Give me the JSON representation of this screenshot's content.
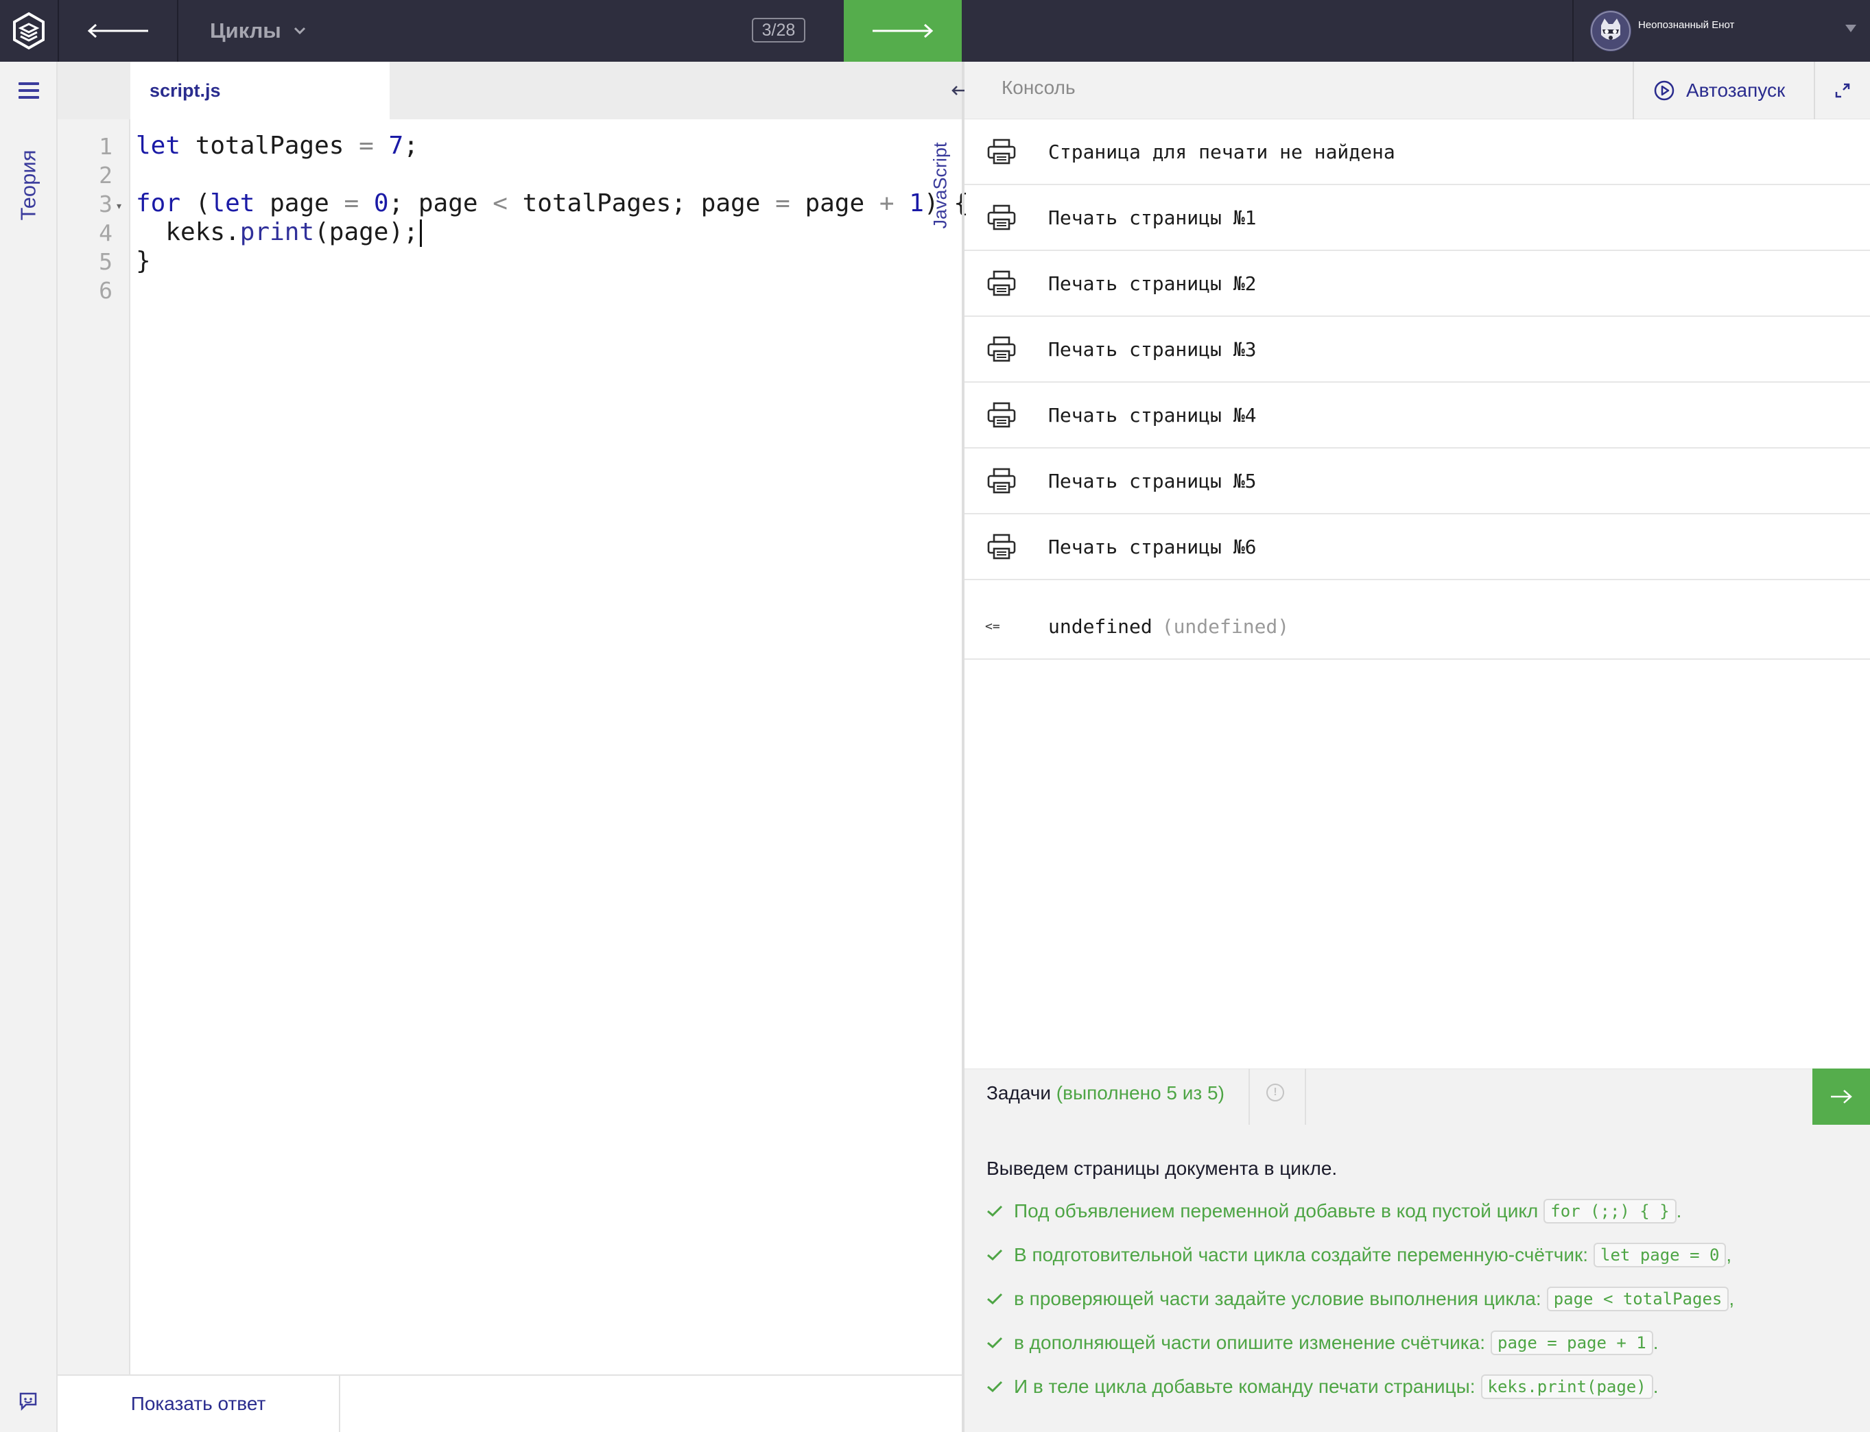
{
  "topbar": {
    "topic": "Циклы",
    "counter": "3/28",
    "user_name": "Неопознанный Енот"
  },
  "sidebar": {
    "theory_label": "Теория",
    "show_answer": "Показать ответ"
  },
  "editor": {
    "file_tab": "script.js",
    "language": "JavaScript",
    "line_numbers": [
      "1",
      "2",
      "3",
      "4",
      "5",
      "6"
    ],
    "code_lines": [
      "let totalPages = 7;",
      "",
      "for (let page = 0; page < totalPages; page = page + 1) {",
      "  keks.print(page);",
      "}",
      ""
    ]
  },
  "console": {
    "title": "Консоль",
    "autorun_label": "Автозапуск",
    "entries": [
      {
        "icon": "printer-icon",
        "text": "Страница для печати не найдена"
      },
      {
        "icon": "printer-icon",
        "text": "Печать страницы №1"
      },
      {
        "icon": "printer-icon",
        "text": "Печать страницы №2"
      },
      {
        "icon": "printer-icon",
        "text": "Печать страницы №3"
      },
      {
        "icon": "printer-icon",
        "text": "Печать страницы №4"
      },
      {
        "icon": "printer-icon",
        "text": "Печать страницы №5"
      },
      {
        "icon": "printer-icon",
        "text": "Печать страницы №6"
      }
    ],
    "return_marker": "<=",
    "return_value": "undefined",
    "return_type": "(undefined)"
  },
  "tasks": {
    "title": "Задачи",
    "progress": "(выполнено 5 из 5)",
    "intro": "Выведем страницы документа в цикле.",
    "items": [
      {
        "text": "Под объявлением переменной добавьте в код пустой цикл",
        "code": "for (;;) { }",
        "punct": "."
      },
      {
        "text": "В подготовительной части цикла создайте переменную-счётчик:",
        "code": "let page = 0",
        "punct": ","
      },
      {
        "text": "в проверяющей части задайте условие выполнения цикла:",
        "code": "page < totalPages",
        "punct": ","
      },
      {
        "text": "в дополняющей части опишите изменение счётчика:",
        "code": "page = page + 1",
        "punct": "."
      },
      {
        "text": "И в теле цикла добавьте команду печати страницы:",
        "code": "keks.print(page)",
        "punct": "."
      }
    ]
  },
  "colors": {
    "topbar_bg": "#2e2e3e",
    "accent_green": "#55ad4c",
    "accent_blue": "#2a2c8e",
    "done_green": "#4ea545"
  }
}
